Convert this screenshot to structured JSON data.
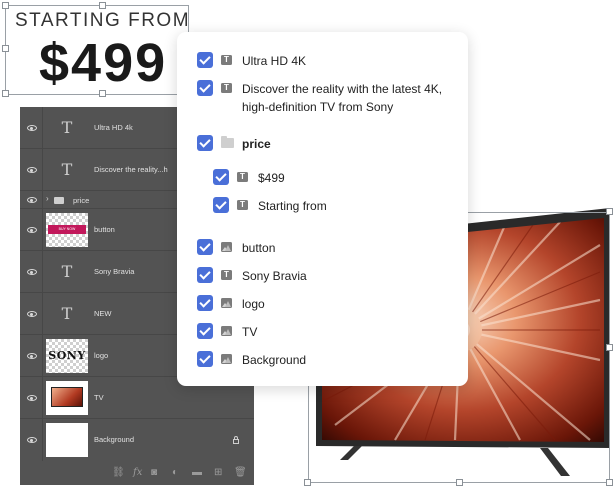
{
  "promo": {
    "starting_text": "STARTING FROM",
    "price_text": "$499"
  },
  "layers_panel": {
    "layers": [
      {
        "name": "Ultra HD 4k",
        "kind": "text"
      },
      {
        "name": "Discover the reality...h",
        "kind": "text"
      },
      {
        "name": "price",
        "kind": "group"
      },
      {
        "name": "button",
        "kind": "image"
      },
      {
        "name": "Sony Bravia",
        "kind": "text"
      },
      {
        "name": "NEW",
        "kind": "text"
      },
      {
        "name": "logo",
        "kind": "image"
      },
      {
        "name": "TV",
        "kind": "image"
      },
      {
        "name": "Background",
        "kind": "image"
      }
    ],
    "thumb_text": {
      "button": "BUY NOW",
      "logo": "SONY"
    },
    "footer_icons": [
      "link-icon",
      "fx-icon",
      "mask-icon",
      "adjustment-icon",
      "folder-icon",
      "new-layer-icon",
      "trash-icon"
    ]
  },
  "checklist": {
    "items": [
      {
        "label": "Ultra HD 4K",
        "icon": "text-layer-icon",
        "checked": true
      },
      {
        "label": "Discover the reality with the latest 4K, high-definition TV from Sony",
        "icon": "text-layer-icon",
        "checked": true
      },
      {
        "label": "price",
        "icon": "folder-icon",
        "checked": true
      },
      {
        "label": "$499",
        "icon": "text-layer-icon",
        "checked": true
      },
      {
        "label": "Starting from",
        "icon": "text-layer-icon",
        "checked": true
      },
      {
        "label": "button",
        "icon": "image-layer-icon",
        "checked": true
      },
      {
        "label": "Sony Bravia",
        "icon": "text-layer-icon",
        "checked": true
      },
      {
        "label": "logo",
        "icon": "image-layer-icon",
        "checked": true
      },
      {
        "label": "TV",
        "icon": "image-layer-icon",
        "checked": true
      },
      {
        "label": "Background",
        "icon": "image-layer-icon",
        "checked": true
      }
    ],
    "text_icon_glyph": "T"
  },
  "colors": {
    "checkbox": "#4a6fd8",
    "layers_panel_bg": "#535353",
    "button_thumb": "#c2185b"
  }
}
